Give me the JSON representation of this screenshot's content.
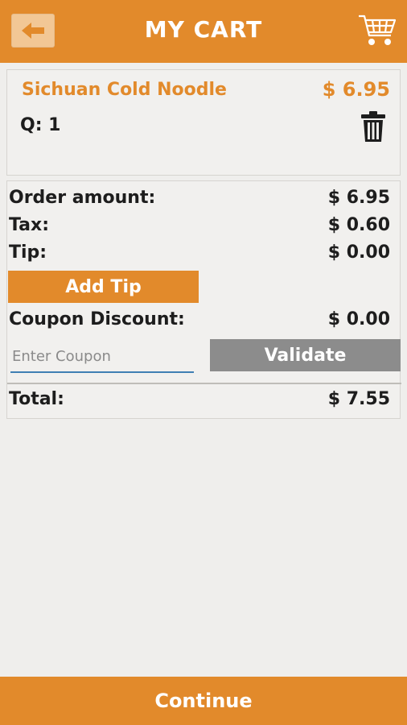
{
  "header": {
    "title": "MY CART",
    "back_icon": "arrow-left-icon",
    "cart_icon": "shopping-cart-icon"
  },
  "cart": {
    "items": [
      {
        "name": "Sichuan Cold Noodle",
        "price": "$ 6.95",
        "quantity": "Q: 1",
        "delete_icon": "trash-icon"
      }
    ]
  },
  "summary": {
    "order_amount_label": "Order amount:",
    "order_amount_value": "$ 6.95",
    "tax_label": "Tax:",
    "tax_value": "$ 0.60",
    "tip_label": "Tip:",
    "tip_value": "$ 0.00",
    "add_tip_label": "Add Tip",
    "coupon_discount_label": "Coupon Discount:",
    "coupon_discount_value": "$ 0.00",
    "coupon_placeholder": "Enter Coupon",
    "validate_label": "Validate",
    "total_label": "Total:",
    "total_value": "$ 7.55"
  },
  "footer": {
    "continue_label": "Continue"
  },
  "colors": {
    "accent": "#e28a2b",
    "accent_light": "#f2c795",
    "button_gray": "#8c8c8c",
    "input_underline": "#3f7fb3",
    "background": "#efeeec"
  }
}
